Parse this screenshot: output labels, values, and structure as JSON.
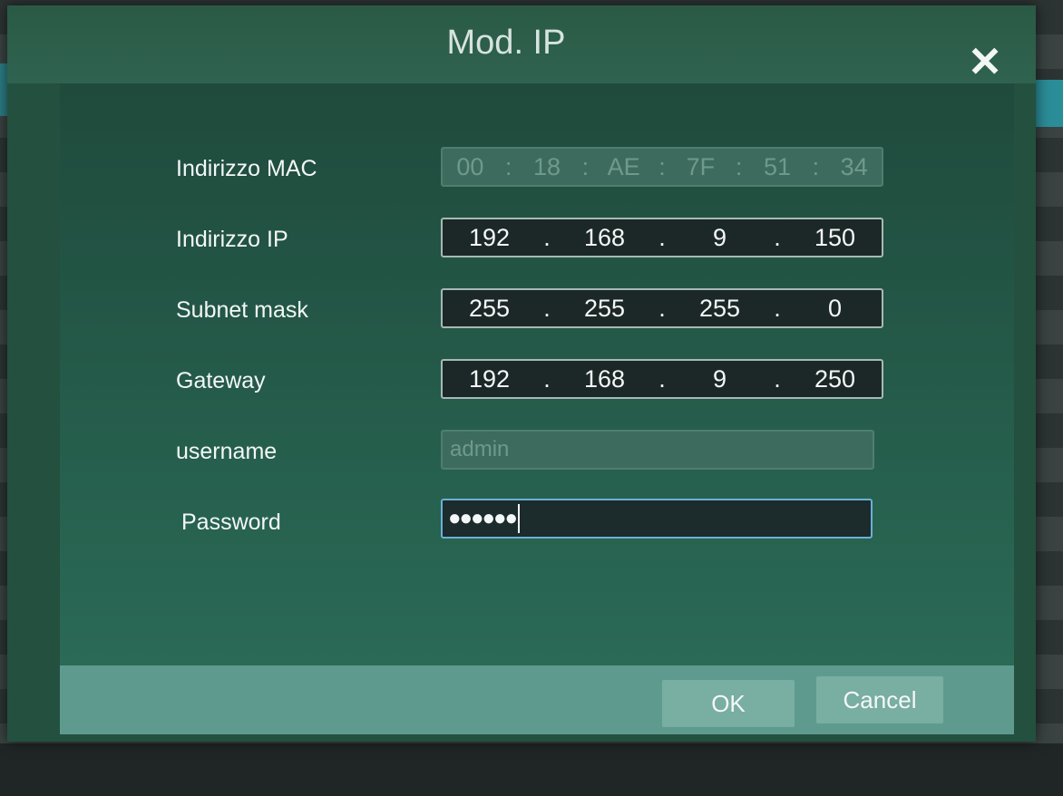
{
  "dialog": {
    "title": "Mod. IP",
    "close_icon": "close-icon"
  },
  "form": {
    "mac": {
      "label": "Indirizzo MAC",
      "segments": [
        "00",
        "18",
        "AE",
        "7F",
        "51",
        "34"
      ],
      "separator": ":"
    },
    "ip": {
      "label": "Indirizzo IP",
      "segments": [
        "192",
        "168",
        "9",
        "150"
      ],
      "separator": "."
    },
    "subnet": {
      "label": "Subnet mask",
      "segments": [
        "255",
        "255",
        "255",
        "0"
      ],
      "separator": "."
    },
    "gateway": {
      "label": "Gateway",
      "segments": [
        "192",
        "168",
        "9",
        "250"
      ],
      "separator": "."
    },
    "username": {
      "label": "username",
      "value": "admin"
    },
    "password": {
      "label": "Password",
      "masked_value": "●●●●●●"
    }
  },
  "buttons": {
    "ok_label": "OK",
    "cancel_label": "Cancel"
  },
  "colors": {
    "dialog_bg": "#24503f",
    "field_bg": "#1c2827",
    "focus_border": "#6bb0d8",
    "button_bg": "#79aea2"
  }
}
